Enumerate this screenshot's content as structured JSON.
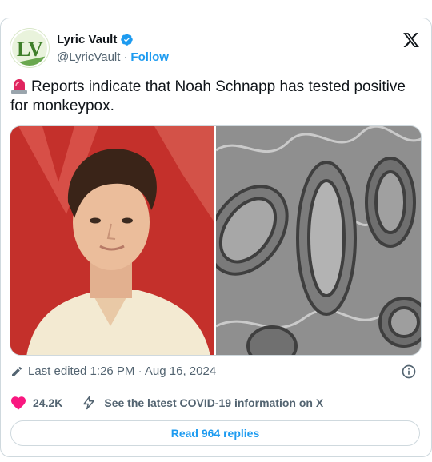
{
  "author": {
    "display_name": "Lyric Vault",
    "handle": "@LyricVault",
    "separator": "·",
    "follow_label": "Follow",
    "avatar_text": "LV"
  },
  "tweet": {
    "text": "Reports indicate that Noah Schnapp has tested positive for monkeypox.",
    "media": [
      {
        "icon": "portrait-photo"
      },
      {
        "icon": "microscope-image"
      }
    ]
  },
  "meta": {
    "edited_text": "Last edited 1:26 PM · Aug 16, 2024"
  },
  "actions": {
    "like_count": "24.2K",
    "covid_info_label": "See the latest COVID-19 information on X",
    "read_replies_label": "Read 964 replies"
  },
  "colors": {
    "accent": "#1d9bf0",
    "like": "#f91880",
    "text": "#0f1419",
    "muted": "#536471"
  }
}
